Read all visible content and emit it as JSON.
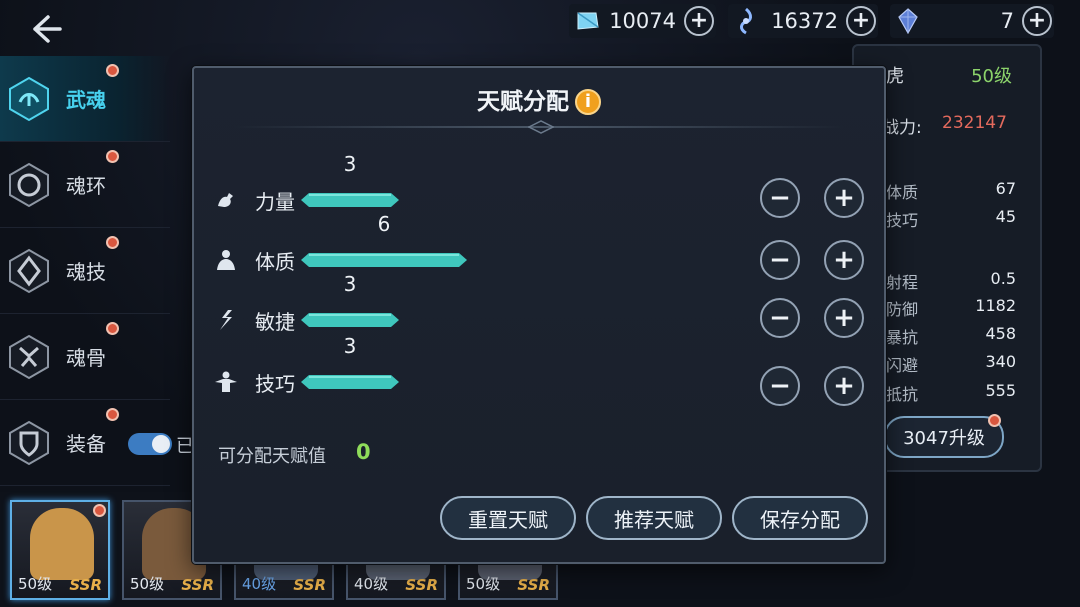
{
  "header": {
    "resources": [
      {
        "icon": "diamond-icon",
        "value": "10074"
      },
      {
        "icon": "soul-crystal-icon",
        "value": "16372"
      },
      {
        "icon": "gem-icon",
        "value": "7"
      }
    ]
  },
  "sidebar": {
    "items": [
      {
        "label": "武魂",
        "icon": "martial-soul-icon",
        "active": true
      },
      {
        "label": "魂环",
        "icon": "soul-ring-icon"
      },
      {
        "label": "魂技",
        "icon": "soul-skill-icon"
      },
      {
        "label": "魂骨",
        "icon": "soul-bone-icon"
      },
      {
        "label": "装备",
        "icon": "equipment-icon"
      }
    ],
    "toggle_text": "已"
  },
  "right_panel": {
    "name": "虎",
    "level": "50级",
    "power_label": "战力:",
    "power_value": "232147",
    "stats": [
      {
        "label": "体质",
        "value": "67"
      },
      {
        "label": "技巧",
        "value": "45"
      },
      {
        "label": "射程",
        "value": "0.5"
      },
      {
        "label": "防御",
        "value": "1182"
      },
      {
        "label": "暴抗",
        "value": "458"
      },
      {
        "label": "闪避",
        "value": "340"
      },
      {
        "label": "抵抗",
        "value": "555"
      }
    ],
    "upgrade_label": "3047升级"
  },
  "cards": [
    {
      "level": "50级",
      "rank": "SSR"
    },
    {
      "level": "50级",
      "rank": "SSR"
    },
    {
      "level": "40级",
      "rank": "SSR"
    },
    {
      "level": "40级",
      "rank": "SSR"
    },
    {
      "level": "50级",
      "rank": "SSR"
    }
  ],
  "modal": {
    "title": "天赋分配",
    "info_icon": "i",
    "talents": [
      {
        "name": "力量",
        "value": "3",
        "icon": "strength-icon"
      },
      {
        "name": "体质",
        "value": "6",
        "icon": "constitution-icon"
      },
      {
        "name": "敏捷",
        "value": "3",
        "icon": "agility-icon"
      },
      {
        "name": "技巧",
        "value": "3",
        "icon": "technique-icon"
      }
    ],
    "minus_label": "−",
    "plus_label": "+",
    "available_label": "可分配天赋值",
    "available_value": "0",
    "buttons": {
      "reset": "重置天赋",
      "recommend": "推荐天赋",
      "save": "保存分配"
    }
  },
  "colors": {
    "bar_teal": "#3fc7bd",
    "accent_cyan": "#47d1ee",
    "available_green": "#8fdc5a",
    "power_red": "#e46a5d",
    "ssr_gold": "#e8b04a"
  }
}
